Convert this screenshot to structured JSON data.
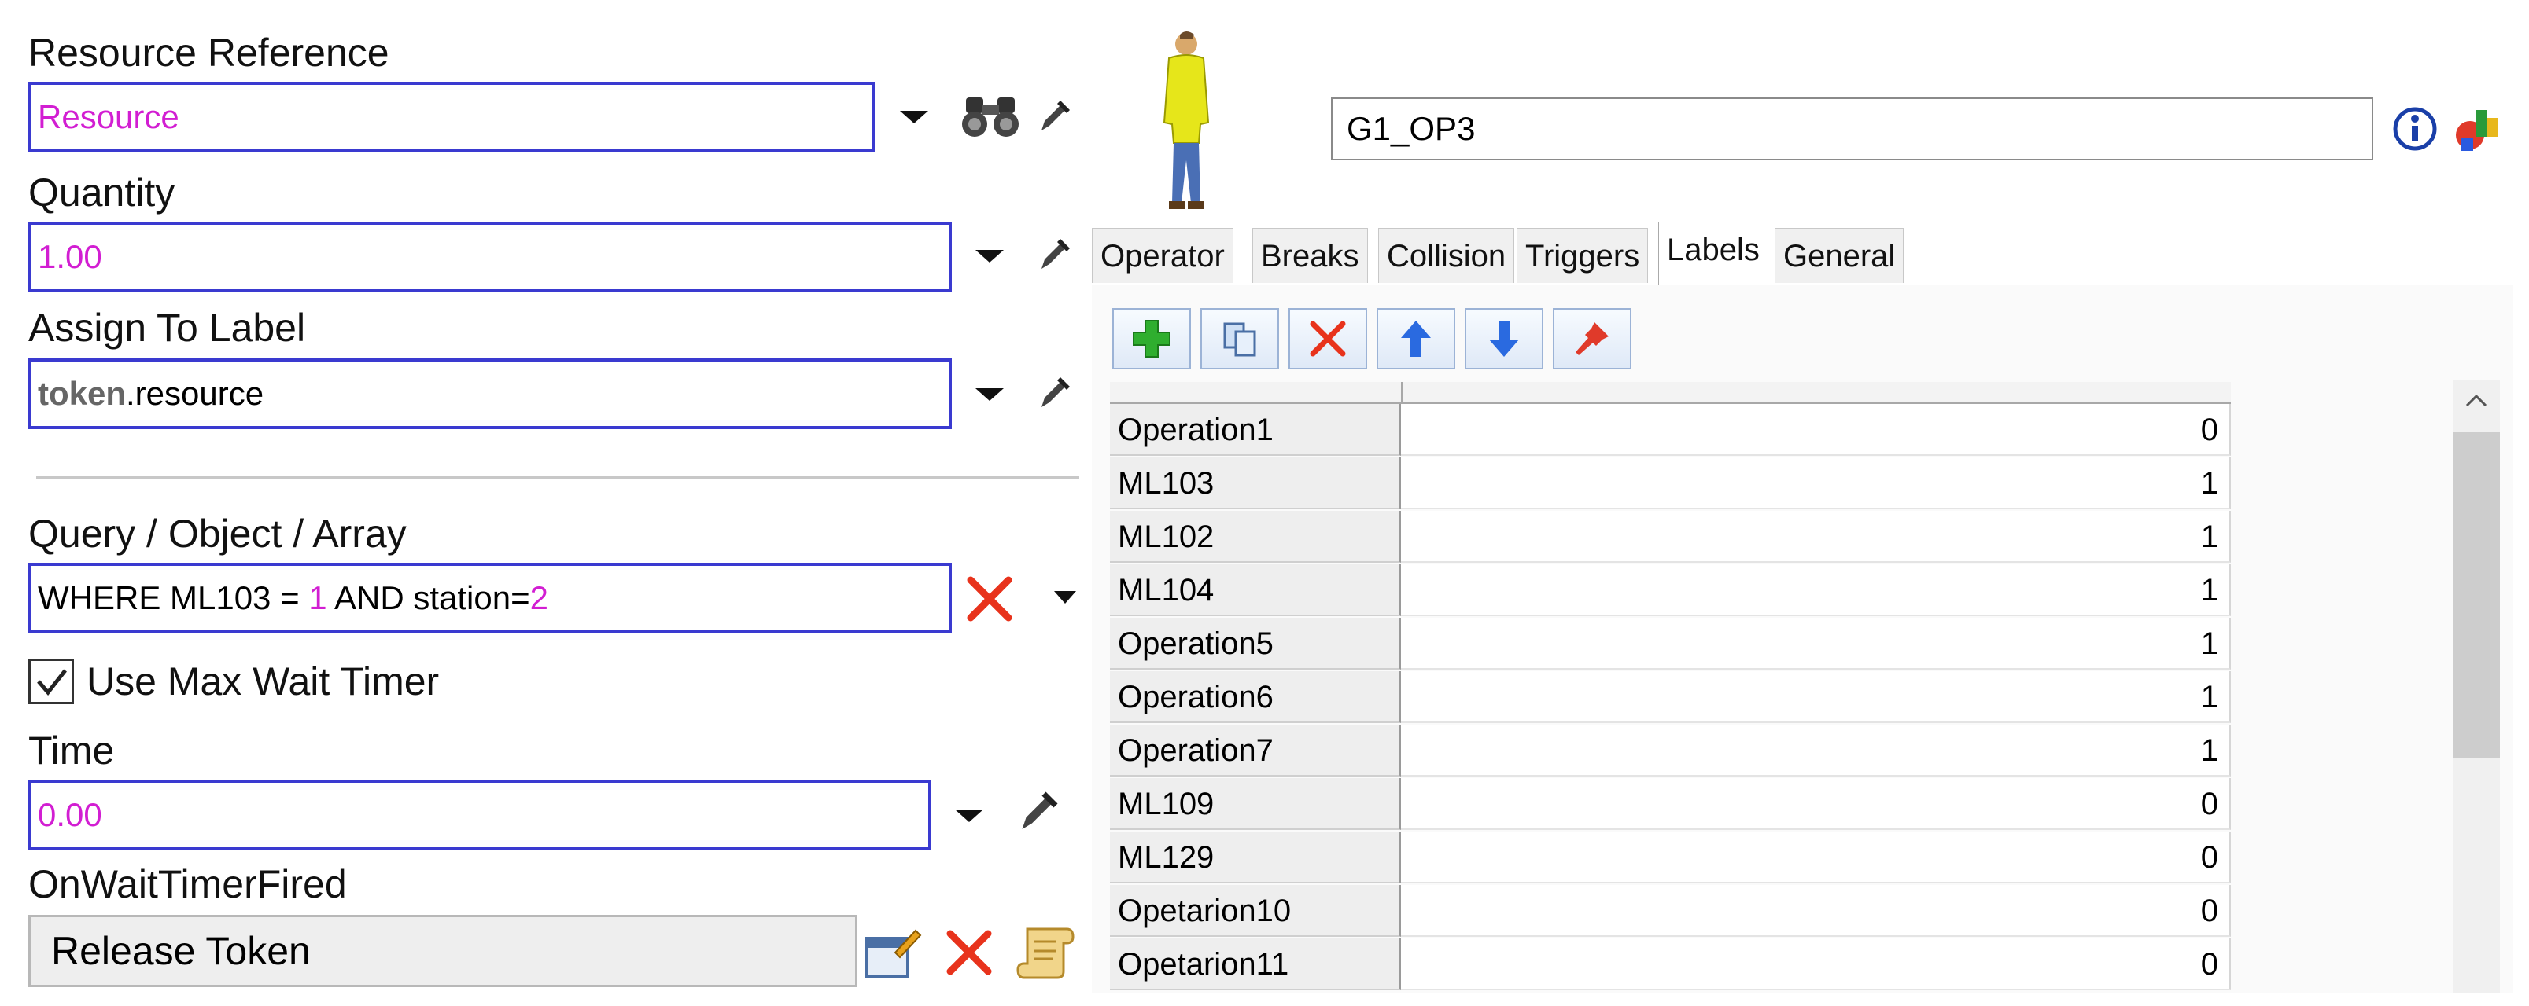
{
  "left": {
    "resource_reference_label": "Resource Reference",
    "resource_value": "Resource",
    "quantity_label": "Quantity",
    "quantity_value": "1.00",
    "assign_label": "Assign To Label",
    "assign_prefix": "token",
    "assign_suffix": ".resource",
    "query_label": "Query / Object / Array",
    "query_part1": "WHERE ML103 = ",
    "query_num1": "1",
    "query_part2": " AND station=",
    "query_num2": "2",
    "max_wait_label": "Use Max Wait Timer",
    "max_wait_checked": true,
    "time_label": "Time",
    "time_value": "0.00",
    "on_wait_label": "OnWaitTimerFired",
    "on_wait_value": "Release Token"
  },
  "right": {
    "object_name": "G1_OP3",
    "tabs": [
      "Operator",
      "Breaks",
      "Collision",
      "Triggers",
      "Labels",
      "General"
    ],
    "active_tab": "Labels",
    "labels_table": [
      {
        "name": "Operation1",
        "value": "0"
      },
      {
        "name": "ML103",
        "value": "1"
      },
      {
        "name": "ML102",
        "value": "1"
      },
      {
        "name": "ML104",
        "value": "1"
      },
      {
        "name": "Operation5",
        "value": "1"
      },
      {
        "name": "Operation6",
        "value": "1"
      },
      {
        "name": "Operation7",
        "value": "1"
      },
      {
        "name": "ML109",
        "value": "0"
      },
      {
        "name": "ML129",
        "value": "0"
      },
      {
        "name": "Opetarion10",
        "value": "0"
      },
      {
        "name": "Opetarion11",
        "value": "0"
      }
    ]
  },
  "colors": {
    "field_border": "#3a3ad0",
    "magenta_value": "#d21ed2",
    "delete_red": "#e8331c"
  },
  "icons": [
    "binoculars-icon",
    "eyedropper-icon",
    "dropdown-arrow-icon",
    "delete-x-icon",
    "info-icon",
    "color-palette-icon",
    "add-icon",
    "copy-icon",
    "move-up-icon",
    "move-down-icon",
    "pin-icon",
    "code-edit-icon",
    "script-icon",
    "operator-person-icon"
  ]
}
